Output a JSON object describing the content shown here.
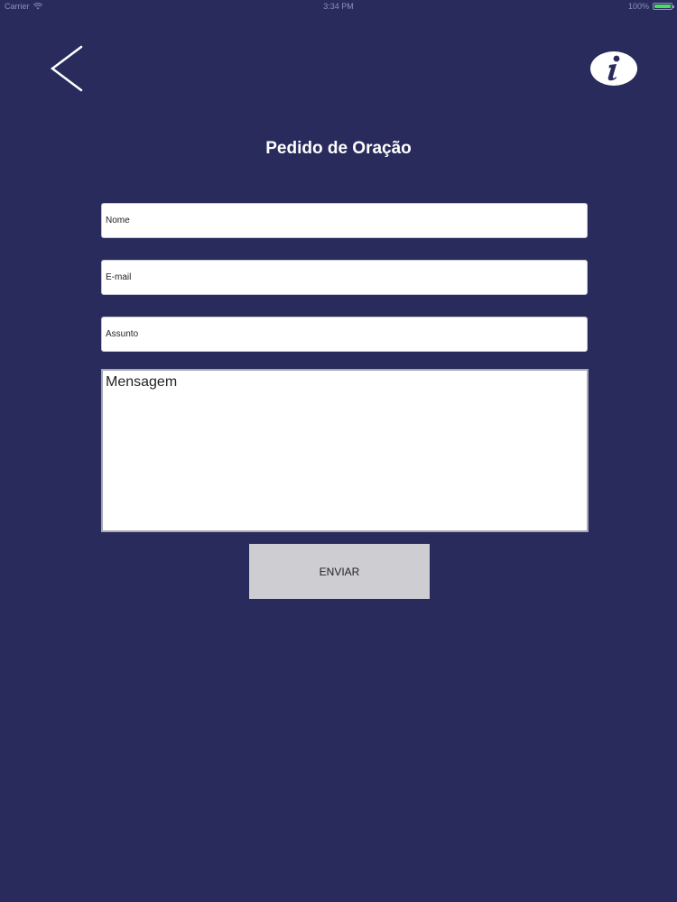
{
  "status_bar": {
    "carrier": "Carrier",
    "time": "3:34 PM",
    "battery": "100%",
    "battery_level": 1.0,
    "battery_color": "#4cd964"
  },
  "nav": {
    "back_icon": "chevron-left-icon",
    "info_icon": "info-icon"
  },
  "page": {
    "title": "Pedido de Oração"
  },
  "form": {
    "name_placeholder": "Nome",
    "email_placeholder": "E-mail",
    "subject_placeholder": "Assunto",
    "message_placeholder": "Mensagem",
    "submit_label": "ENVIAR"
  },
  "colors": {
    "background": "#292b5c",
    "button": "#cecdd2",
    "text_light": "#ffffff"
  }
}
